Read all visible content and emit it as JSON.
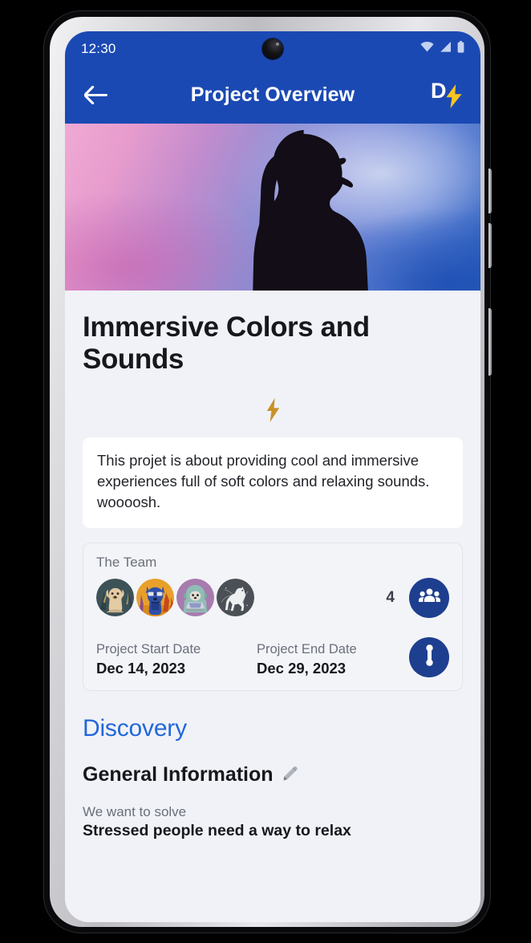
{
  "status_bar": {
    "time": "12:30",
    "icons": [
      "wifi-icon",
      "cellular-signal-icon",
      "battery-icon"
    ]
  },
  "app_bar": {
    "back_icon": "arrow-left-icon",
    "title": "Project Overview",
    "logo_letter": "D",
    "logo_icon": "lightning-bolt-icon"
  },
  "hero": {
    "alt": "silhouette-of-woman-profile-with-ponytail",
    "gradient_from": "#F0A9D4",
    "gradient_to": "#2B5FBE"
  },
  "project": {
    "title": "Immersive Colors and Sounds",
    "accent_bolt_icon": "lightning-bolt-icon",
    "description": "This projet is about providing cool and immersive experiences full of soft colors and relaxing sounds. woooosh."
  },
  "team": {
    "label": "The Team",
    "count": "4",
    "members_button_icon": "people-group-icon",
    "avatars": [
      {
        "name": "avatar-tan-dog",
        "bg": "#3C5257"
      },
      {
        "name": "avatar-blue-dog-glasses",
        "bg": "#E8A02B"
      },
      {
        "name": "avatar-hooded-dog-laptop",
        "bg": "#A77BAE"
      },
      {
        "name": "avatar-white-dog-sketch",
        "bg": "#4A5055"
      }
    ]
  },
  "dates": {
    "start_label": "Project Start Date",
    "start_value": "Dec 14, 2023",
    "end_label": "Project End Date",
    "end_value": "Dec 29, 2023",
    "timeline_button_icon": "timeline-icon"
  },
  "discovery": {
    "heading": "Discovery",
    "general_info_title": "General Information",
    "edit_icon": "pencil-icon",
    "solve_label": "We want to solve",
    "solve_value": "Stressed people need a way to relax"
  },
  "colors": {
    "app_bar": "#1B49B3",
    "page_bg": "#F1F2F7",
    "accent_blue": "#2268DA",
    "button_blue": "#1E3F8F",
    "bolt_gold": "#C8922A"
  }
}
